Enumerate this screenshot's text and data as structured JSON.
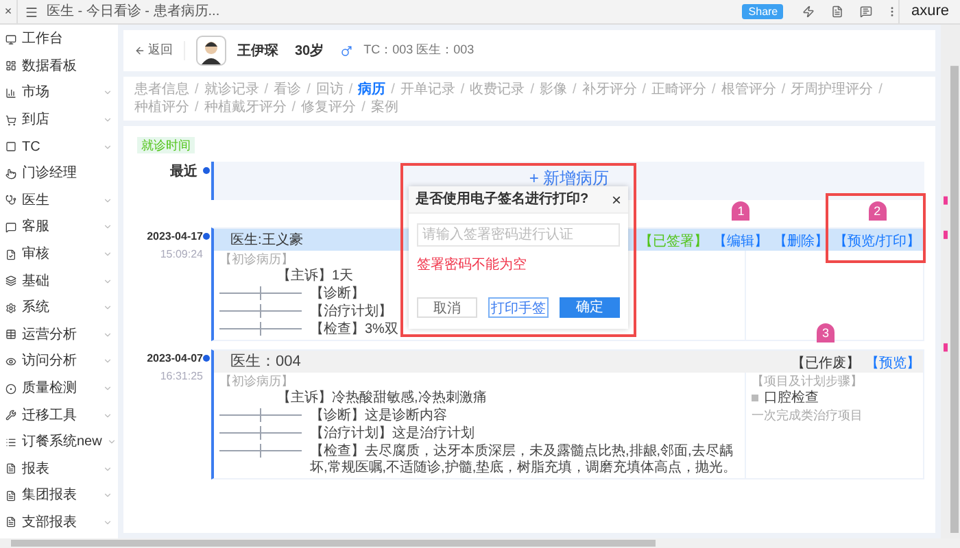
{
  "toolbar": {
    "close": "×",
    "title": "医生 - 今日看诊 - 患者病历...",
    "share": "Share",
    "logo": "axure"
  },
  "sidebar": {
    "items": [
      {
        "label": "工作台",
        "expandable": false
      },
      {
        "label": "数据看板",
        "expandable": false
      },
      {
        "label": "市场",
        "expandable": true
      },
      {
        "label": "到店",
        "expandable": true
      },
      {
        "label": "TC",
        "expandable": true
      },
      {
        "label": "门诊经理",
        "expandable": false
      },
      {
        "label": "医生",
        "expandable": true
      },
      {
        "label": "客服",
        "expandable": true
      },
      {
        "label": "审核",
        "expandable": true
      },
      {
        "label": "基础",
        "expandable": true
      },
      {
        "label": "系统",
        "expandable": true
      },
      {
        "label": "运营分析",
        "expandable": true
      },
      {
        "label": "访问分析",
        "expandable": true
      },
      {
        "label": "质量检测",
        "expandable": true
      },
      {
        "label": "迁移工具",
        "expandable": true
      },
      {
        "label": "订餐系统new",
        "expandable": true
      },
      {
        "label": "报表",
        "expandable": true
      },
      {
        "label": "集团报表",
        "expandable": true
      },
      {
        "label": "支部报表",
        "expandable": true
      }
    ]
  },
  "patient": {
    "back": "返回",
    "name": "王伊琛",
    "age": "30岁",
    "staff": "TC：003 医生：003"
  },
  "tab_bar": {
    "separator": "/",
    "tabs": [
      {
        "label": "患者信息",
        "selected": false
      },
      {
        "label": "就诊记录",
        "selected": false
      },
      {
        "label": "看诊",
        "selected": false
      },
      {
        "label": "回访",
        "selected": false
      },
      {
        "label": "病历",
        "selected": true
      },
      {
        "label": "开单记录",
        "selected": false
      },
      {
        "label": "收费记录",
        "selected": false
      },
      {
        "label": "影像",
        "selected": false
      },
      {
        "label": "补牙评分",
        "selected": false
      },
      {
        "label": "正畸评分",
        "selected": false
      },
      {
        "label": "根管评分",
        "selected": false
      },
      {
        "label": "牙周护理评分",
        "selected": false
      },
      {
        "label": "种植评分",
        "selected": false
      },
      {
        "label": "种植戴牙评分",
        "selected": false
      },
      {
        "label": "修复评分",
        "selected": false
      },
      {
        "label": "案例",
        "selected": false
      }
    ]
  },
  "time_tag": "就诊时间",
  "latest": {
    "label": "最近",
    "add": "+ 新增病历"
  },
  "records": [
    {
      "date": "2023-04-17",
      "time": "15:09:24",
      "doctor": "医生:王义豪",
      "active": true,
      "type_label": "【初诊病历】",
      "actions": [
        {
          "label": "【已签署】",
          "kind": "status",
          "highlighted": false
        },
        {
          "label": "【编辑】",
          "kind": "link",
          "marker": "1",
          "highlighted": false
        },
        {
          "label": "【删除】",
          "kind": "link",
          "highlighted": false
        },
        {
          "label": "【预览/打印】",
          "kind": "link",
          "marker": "2",
          "highlighted": true
        }
      ],
      "fields": [
        {
          "label": "【主诉】",
          "text": "1天",
          "kind": "plain"
        },
        {
          "label": "【诊断】",
          "kind": "chart"
        },
        {
          "label": "【治疗计划】",
          "kind": "chart"
        },
        {
          "label": "【检查】",
          "text": "3%双",
          "kind": "chart"
        }
      ]
    },
    {
      "date": "2023-04-07",
      "time": "16:31:25",
      "doctor": "医生：004",
      "active": false,
      "type_label": "【初诊病历】",
      "actions": [
        {
          "label": "【已作废】",
          "kind": "void",
          "marker": "3",
          "highlighted": false
        },
        {
          "label": "【预览】",
          "kind": "link",
          "highlighted": false
        }
      ],
      "fields": [
        {
          "label": "【主诉】",
          "text": "冷热酸甜敏感,冷热刺激痛",
          "kind": "plain"
        },
        {
          "label": "【诊断】",
          "text": "这是诊断内容",
          "kind": "chart"
        },
        {
          "label": "【治疗计划】",
          "text": "这是治疗计划",
          "kind": "chart"
        },
        {
          "label": "【检查】",
          "text": "去尽腐质，达牙本质深层，未及露髓点比热,排龈,邻面,去尽龋坏,常规医嘱,不适随诊,护髓,垫底，树脂充填，调磨充填体高点，抛光。",
          "kind": "chart"
        }
      ],
      "side": {
        "title": "【项目及计划步骤】",
        "item": "口腔检查",
        "note": "一次完成类治疗项目"
      }
    }
  ],
  "dialog": {
    "title": "是否使用电子签名进行打印?",
    "close": "×",
    "placeholder": "请输入签署密码进行认证",
    "error": "签署密码不能为空",
    "buttons": [
      {
        "label": "取消",
        "kind": "default"
      },
      {
        "label": "打印手签",
        "kind": "outline"
      },
      {
        "label": "确定",
        "kind": "primary"
      }
    ]
  }
}
